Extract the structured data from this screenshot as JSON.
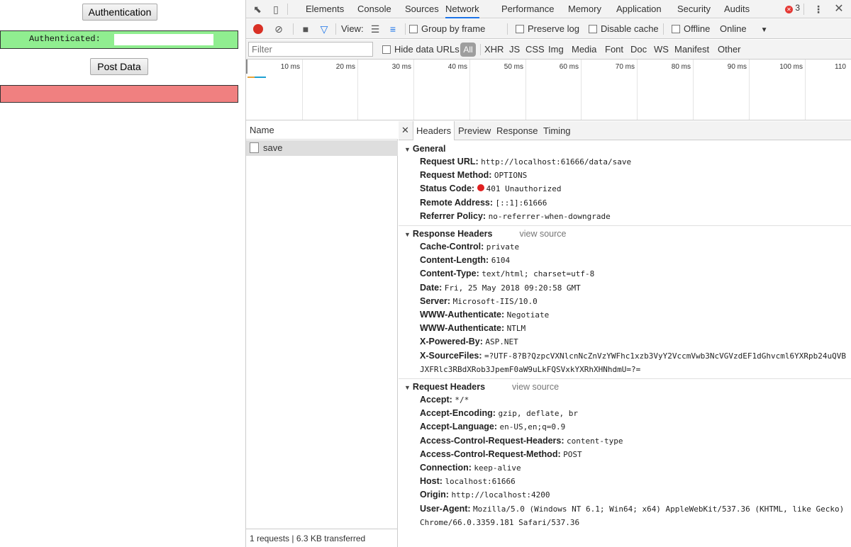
{
  "page": {
    "auth_button": "Authentication",
    "auth_status": "Authenticated: ",
    "post_button": "Post Data"
  },
  "devtools": {
    "tabs": [
      "Elements",
      "Console",
      "Sources",
      "Network",
      "Performance",
      "Memory",
      "Application",
      "Security",
      "Audits"
    ],
    "active_tab": "Network",
    "error_count": "3",
    "toolbar": {
      "view_label": "View:",
      "group_by_frame": "Group by frame",
      "preserve_log": "Preserve log",
      "disable_cache": "Disable cache",
      "offline": "Offline",
      "throttle": "Online"
    },
    "filter": {
      "placeholder": "Filter",
      "hide_data_urls": "Hide data URLs",
      "types": [
        "All",
        "XHR",
        "JS",
        "CSS",
        "Img",
        "Media",
        "Font",
        "Doc",
        "WS",
        "Manifest",
        "Other"
      ]
    },
    "timeline_ticks": [
      "10 ms",
      "20 ms",
      "30 ms",
      "40 ms",
      "50 ms",
      "60 ms",
      "70 ms",
      "80 ms",
      "90 ms",
      "100 ms",
      "110"
    ],
    "list": {
      "name_header": "Name",
      "requests": [
        "save"
      ],
      "summary": "1 requests | 6.3 KB transferred"
    },
    "detail_tabs": [
      "Headers",
      "Preview",
      "Response",
      "Timing"
    ],
    "general": {
      "title": "General",
      "rows": [
        {
          "k": "Request URL:",
          "v": "http://localhost:61666/data/save"
        },
        {
          "k": "Request Method:",
          "v": "OPTIONS"
        },
        {
          "k": "Status Code:",
          "v": "401 Unauthorized"
        },
        {
          "k": "Remote Address:",
          "v": "[::1]:61666"
        },
        {
          "k": "Referrer Policy:",
          "v": "no-referrer-when-downgrade"
        }
      ]
    },
    "response_headers": {
      "title": "Response Headers",
      "view_source": "view source",
      "rows": [
        {
          "k": "Cache-Control:",
          "v": "private"
        },
        {
          "k": "Content-Length:",
          "v": "6104"
        },
        {
          "k": "Content-Type:",
          "v": "text/html; charset=utf-8"
        },
        {
          "k": "Date:",
          "v": "Fri, 25 May 2018 09:20:58 GMT"
        },
        {
          "k": "Server:",
          "v": "Microsoft-IIS/10.0"
        },
        {
          "k": "WWW-Authenticate:",
          "v": "Negotiate"
        },
        {
          "k": "WWW-Authenticate:",
          "v": "NTLM"
        },
        {
          "k": "X-Powered-By:",
          "v": "ASP.NET"
        },
        {
          "k": "X-SourceFiles:",
          "v": "=?UTF-8?B?QzpcVXNlcnNcZnVzYWFhc1xzb3VyY2VccmVwb3NcVGVzdEF1dGhvcml6YXRpb24uQVBJXFRlc3RBdXRob3JpemF0aW9uLkFQSVxkYXRhXHNhdmU=?="
        }
      ]
    },
    "request_headers": {
      "title": "Request Headers",
      "view_source": "view source",
      "rows": [
        {
          "k": "Accept:",
          "v": "*/*"
        },
        {
          "k": "Accept-Encoding:",
          "v": "gzip, deflate, br"
        },
        {
          "k": "Accept-Language:",
          "v": "en-US,en;q=0.9"
        },
        {
          "k": "Access-Control-Request-Headers:",
          "v": "content-type"
        },
        {
          "k": "Access-Control-Request-Method:",
          "v": "POST"
        },
        {
          "k": "Connection:",
          "v": "keep-alive"
        },
        {
          "k": "Host:",
          "v": "localhost:61666"
        },
        {
          "k": "Origin:",
          "v": "http://localhost:4200"
        },
        {
          "k": "User-Agent:",
          "v": "Mozilla/5.0 (Windows NT 6.1; Win64; x64) AppleWebKit/537.36 (KHTML, like Gecko) Chrome/66.0.3359.181 Safari/537.36"
        }
      ]
    },
    "colors": {
      "auth_ok": "#90ee90",
      "auth_error": "#f08080",
      "record": "#d93025",
      "status_error": "#e02020"
    }
  }
}
